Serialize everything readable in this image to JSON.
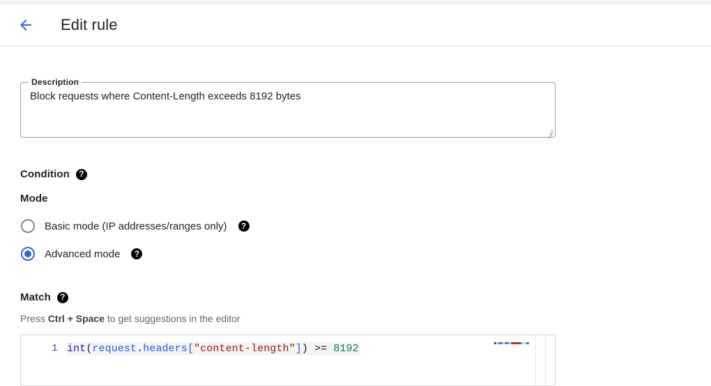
{
  "header": {
    "back_icon": "arrow-left-icon",
    "title": "Edit rule"
  },
  "description_field": {
    "label": "Description",
    "value": "Block requests where Content-Length exceeds 8192 bytes",
    "placeholder": ""
  },
  "condition": {
    "heading": "Condition",
    "help_icon": "?"
  },
  "mode": {
    "heading": "Mode",
    "options": [
      {
        "label": "Basic mode (IP addresses/ranges only)",
        "selected": false,
        "help_icon": "?"
      },
      {
        "label": "Advanced mode",
        "selected": true,
        "help_icon": "?"
      }
    ]
  },
  "match": {
    "heading": "Match",
    "help_icon": "?",
    "hint_prefix": "Press ",
    "hint_shortcut": "Ctrl + Space",
    "hint_suffix": " to get suggestions in the editor",
    "editor": {
      "line_number": "1",
      "code": "int(request.headers[\"content-length\"]) >= 8192",
      "tokens": [
        {
          "text": "int",
          "type": "keyword"
        },
        {
          "text": "(",
          "type": "punct"
        },
        {
          "text": "request",
          "type": "ident"
        },
        {
          "text": ".",
          "type": "punct"
        },
        {
          "text": "headers",
          "type": "ident"
        },
        {
          "text": "[",
          "type": "bracket"
        },
        {
          "text": "\"content-length\"",
          "type": "string"
        },
        {
          "text": "]",
          "type": "bracket"
        },
        {
          "text": ")",
          "type": "punct"
        },
        {
          "text": " >= ",
          "type": "operator"
        },
        {
          "text": "8192",
          "type": "number"
        }
      ]
    }
  },
  "colors": {
    "accent_blue": "#3367d6",
    "back_arrow_blue": "#3b63d0",
    "keyword": "#1a1aa6",
    "identifier": "#2a5bd7",
    "string": "#a31515",
    "number": "#0b7b5e",
    "help_icon_bg": "#000000",
    "muted_text": "#5f6368",
    "border": "#9aa0a6"
  }
}
